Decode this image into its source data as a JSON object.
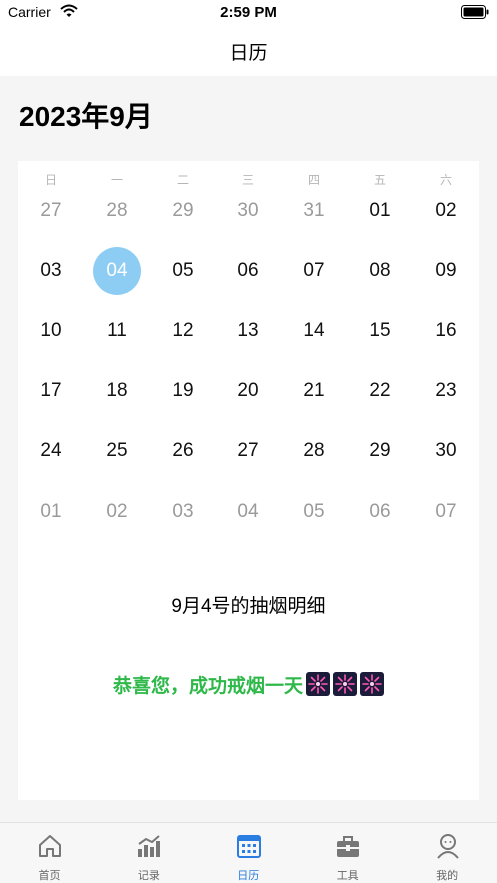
{
  "status_bar": {
    "carrier": "Carrier",
    "time": "2:59 PM"
  },
  "nav": {
    "title": "日历"
  },
  "calendar": {
    "month_title": "2023年9月",
    "weekdays": [
      "日",
      "一",
      "二",
      "三",
      "四",
      "五",
      "六"
    ],
    "weeks": [
      [
        {
          "d": "27",
          "m": true
        },
        {
          "d": "28",
          "m": true
        },
        {
          "d": "29",
          "m": true
        },
        {
          "d": "30",
          "m": true
        },
        {
          "d": "31",
          "m": true
        },
        {
          "d": "01",
          "m": false
        },
        {
          "d": "02",
          "m": false
        }
      ],
      [
        {
          "d": "03",
          "m": false
        },
        {
          "d": "04",
          "m": false,
          "sel": true
        },
        {
          "d": "05",
          "m": false
        },
        {
          "d": "06",
          "m": false
        },
        {
          "d": "07",
          "m": false
        },
        {
          "d": "08",
          "m": false
        },
        {
          "d": "09",
          "m": false
        }
      ],
      [
        {
          "d": "10",
          "m": false
        },
        {
          "d": "11",
          "m": false
        },
        {
          "d": "12",
          "m": false
        },
        {
          "d": "13",
          "m": false
        },
        {
          "d": "14",
          "m": false
        },
        {
          "d": "15",
          "m": false
        },
        {
          "d": "16",
          "m": false
        }
      ],
      [
        {
          "d": "17",
          "m": false
        },
        {
          "d": "18",
          "m": false
        },
        {
          "d": "19",
          "m": false
        },
        {
          "d": "20",
          "m": false
        },
        {
          "d": "21",
          "m": false
        },
        {
          "d": "22",
          "m": false
        },
        {
          "d": "23",
          "m": false
        }
      ],
      [
        {
          "d": "24",
          "m": false
        },
        {
          "d": "25",
          "m": false
        },
        {
          "d": "26",
          "m": false
        },
        {
          "d": "27",
          "m": false
        },
        {
          "d": "28",
          "m": false
        },
        {
          "d": "29",
          "m": false
        },
        {
          "d": "30",
          "m": false
        }
      ],
      [
        {
          "d": "01",
          "m": true
        },
        {
          "d": "02",
          "m": true
        },
        {
          "d": "03",
          "m": true
        },
        {
          "d": "04",
          "m": true
        },
        {
          "d": "05",
          "m": true
        },
        {
          "d": "06",
          "m": true
        },
        {
          "d": "07",
          "m": true
        }
      ]
    ],
    "selected_color": "#8ecdf3"
  },
  "detail": {
    "title": "9月4号的抽烟明细",
    "message": "恭喜您，成功戒烟一天",
    "message_color": "#2fb84a",
    "fireworks_icon": "firework-icon"
  },
  "tabs": [
    {
      "label": "首页",
      "icon": "home-icon",
      "active": false
    },
    {
      "label": "记录",
      "icon": "bar-chart-icon",
      "active": false
    },
    {
      "label": "日历",
      "icon": "calendar-icon",
      "active": true
    },
    {
      "label": "工具",
      "icon": "toolbox-icon",
      "active": false
    },
    {
      "label": "我的",
      "icon": "profile-icon",
      "active": false
    }
  ],
  "accent_color": "#2a7de1"
}
